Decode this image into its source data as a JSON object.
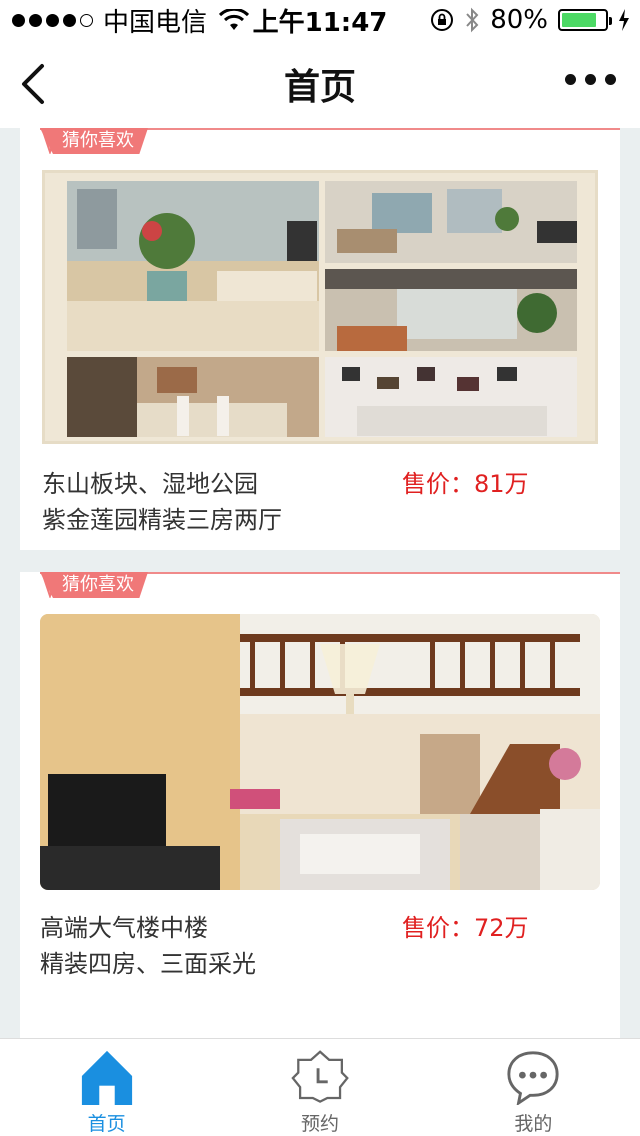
{
  "status_bar": {
    "carrier": "中国电信",
    "time": "上午11:47",
    "battery": "80%",
    "battery_level": 0.8
  },
  "nav": {
    "title": "首页"
  },
  "listings": [
    {
      "tag": "猜你喜欢",
      "title_line1": "东山板块、湿地公园",
      "title_line2": "紫金莲园精装三房两厅",
      "price": "售价：81万"
    },
    {
      "tag": "猜你喜欢",
      "title_line1": "高端大气楼中楼",
      "title_line2": "精装四房、三面采光",
      "price": "售价：72万"
    }
  ],
  "tabs": [
    {
      "label": "首页",
      "icon": "home-icon",
      "active": true
    },
    {
      "label": "预约",
      "icon": "clock-badge-icon",
      "active": false
    },
    {
      "label": "我的",
      "icon": "chat-bubble-icon",
      "active": false
    }
  ],
  "colors": {
    "accent": "#1a8fe0",
    "price": "#e02020",
    "tag": "#f07878"
  }
}
